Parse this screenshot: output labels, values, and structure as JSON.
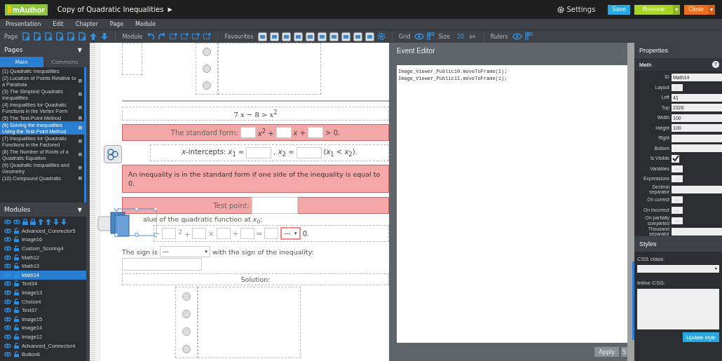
{
  "header": {
    "logo": "mAuthor",
    "title": "Copy of Quadratic Inequalities",
    "title_arrow": "▶",
    "settings": "Settings",
    "save": "Save",
    "preview": "Preview",
    "close": "Close",
    "dropdown_caret": "▾"
  },
  "menu": [
    "Presentation",
    "Edit",
    "Chapter",
    "Page",
    "Module"
  ],
  "toolbar": {
    "page": "Page",
    "module": "Module",
    "favourites": "Favourites",
    "grid": "Grid",
    "size_label": "Size",
    "size_value": "20",
    "size_unit": "px",
    "rulers": "Rulers"
  },
  "pages": {
    "title": "Pages",
    "caret": "▼",
    "tabs": [
      {
        "label": "Main",
        "selected": true
      },
      {
        "label": "Commons",
        "selected": false
      }
    ],
    "items": [
      {
        "label": "(1) Quadratic Inequalities",
        "selected": false
      },
      {
        "label": "(2) Location of Points Relative to a Parabola",
        "badge": "R",
        "selected": false
      },
      {
        "label": "(3) The Simplest Quadratic Inequalities",
        "badge": "R",
        "selected": false
      },
      {
        "label": "(4) Inequalities for Quadratic Functions in the Vertex Form",
        "badge": "R",
        "selected": false
      },
      {
        "label": "(5) The Test-Point Method",
        "badge": "R",
        "selected": false
      },
      {
        "label": "(6) Solving the Inequalities Using the Test-Point Method",
        "badge": "R",
        "selected": true
      },
      {
        "label": "(7) Inequalities for Quadratic Functions in the Factored",
        "badge": "R",
        "selected": false
      },
      {
        "label": "(8) The Number of Roots of a Quadratic Equation",
        "badge": "R",
        "selected": false
      },
      {
        "label": "(9) Quadratic Inequalities and Geometry",
        "badge": "R",
        "selected": false
      },
      {
        "label": "(10) Compound Quadratic",
        "badge": "R",
        "selected": false
      }
    ]
  },
  "modules": {
    "title": "Modules",
    "caret": "▼",
    "items": [
      {
        "name": "Advanced_Connector5",
        "selected": false
      },
      {
        "name": "Image16",
        "selected": false
      },
      {
        "name": "Custom_Scoring4",
        "selected": false
      },
      {
        "name": "Math12",
        "selected": false
      },
      {
        "name": "Math13",
        "selected": false
      },
      {
        "name": "Math14",
        "selected": true
      },
      {
        "name": "Text34",
        "selected": false
      },
      {
        "name": "Image13",
        "selected": false
      },
      {
        "name": "Choice4",
        "selected": false
      },
      {
        "name": "Text37",
        "selected": false
      },
      {
        "name": "Image15",
        "selected": false
      },
      {
        "name": "Image14",
        "selected": false
      },
      {
        "name": "Image12",
        "selected": false
      },
      {
        "name": "Advanced_Connector4",
        "selected": false
      },
      {
        "name": "Button6",
        "selected": false
      }
    ]
  },
  "canvas": {
    "top_choices": [
      {
        "selected": false
      },
      {
        "selected": false
      },
      {
        "selected": false
      }
    ],
    "bottom_choices": [
      {
        "selected": false
      },
      {
        "selected": false
      },
      {
        "selected": false
      },
      {
        "selected": false
      }
    ],
    "equation": "7 *x* − 8 > *x*$^{2}$",
    "standard_form": {
      "label": "The standard form:",
      "part_1": "*x*$^{2}$ +",
      "part_2": "*x* +",
      "part_3": "> 0."
    },
    "intercepts": {
      "label": "*x*-intercepts: *x*$_{1}$ ≈",
      "part_2": ", *x*$_{2}$ ≈",
      "part_3": "(*x*$_{1}$ < *x*$_{2}$)."
    },
    "note": "An inequality is in the standard form if one side of the inequality is equal to 0.",
    "test_point": "Test point:",
    "value_line": "alue of the quadratic function at *x*$_{0}$:",
    "calc": {
      "minus": "−",
      "square_plus": "$^{2}$ +",
      "times": "×",
      "plus": "+",
      "equals": "=",
      "select": "---",
      "select_caret": "▾",
      "zero": "0."
    },
    "sign": {
      "label": "The sign is",
      "select": "---",
      "select_caret": "▾",
      "rest": "with the sign of the inequality:"
    },
    "solution": "Solution:"
  },
  "event_editor": {
    "title": "Event Editor",
    "code": [
      "Image_Viewer_Public10.moveToFrame(1);",
      "Image_Viewer_Public11.moveToFrame(1);"
    ],
    "apply": "Apply",
    "second_button": "S"
  },
  "properties": {
    "title": "Properties",
    "section": "Math",
    "help": "?",
    "rows": [
      {
        "label": "ID",
        "kind": "text",
        "value": "Math14"
      },
      {
        "label": "Layout",
        "kind": "button",
        "value": "..."
      },
      {
        "label": "Left",
        "kind": "text",
        "value": "41"
      },
      {
        "label": "Top",
        "kind": "text",
        "value": "2326"
      },
      {
        "label": "Width",
        "kind": "text",
        "value": "100"
      },
      {
        "label": "Height",
        "kind": "text",
        "value": "100"
      },
      {
        "label": "Right",
        "kind": "text"
      },
      {
        "label": "Bottom",
        "kind": "text"
      },
      {
        "label": "Is Visible",
        "kind": "checkbox",
        "checked": true
      },
      {
        "label": "Variables",
        "kind": "button",
        "value": "..."
      },
      {
        "label": "Expressions",
        "kind": "button",
        "value": "..."
      },
      {
        "label": "Decimal separator",
        "kind": "text"
      },
      {
        "label": "On correct",
        "kind": "button",
        "value": "..."
      },
      {
        "label": "On incorrect",
        "kind": "button",
        "value": "..."
      },
      {
        "label": "On partially completed",
        "kind": "button",
        "value": "..."
      },
      {
        "label": "Thousand separator",
        "kind": "text"
      }
    ]
  },
  "styles": {
    "title": "Styles",
    "css_class": "CSS class:",
    "select_caret": "▾",
    "inline_css": "Inline CSS:",
    "update": "Update style"
  }
}
